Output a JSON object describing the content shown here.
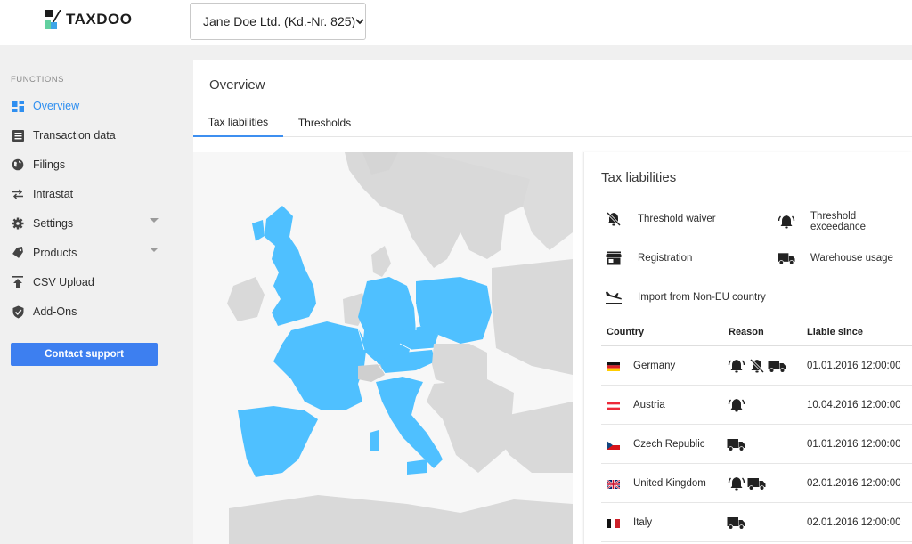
{
  "header": {
    "logo_text": "TAXDOO",
    "client_select": "Jane Doe Ltd. (Kd.-Nr. 825)"
  },
  "sidebar": {
    "heading": "FUNCTIONS",
    "items": [
      {
        "label": "Overview",
        "icon": "dashboard-icon",
        "active": true
      },
      {
        "label": "Transaction data",
        "icon": "list-icon"
      },
      {
        "label": "Filings",
        "icon": "globe-icon"
      },
      {
        "label": "Intrastat",
        "icon": "swap-arrows-icon"
      },
      {
        "label": "Settings",
        "icon": "gear-icon",
        "expandable": true
      },
      {
        "label": "Products",
        "icon": "tag-icon",
        "expandable": true
      },
      {
        "label": "CSV Upload",
        "icon": "upload-icon"
      },
      {
        "label": "Add-Ons",
        "icon": "shield-check-icon"
      }
    ],
    "support_button": "Contact support"
  },
  "main": {
    "title": "Overview",
    "tabs": [
      {
        "label": "Tax liabilities",
        "active": true
      },
      {
        "label": "Thresholds"
      }
    ]
  },
  "panel": {
    "title": "Tax liabilities",
    "legend": {
      "threshold_waiver": "Threshold waiver",
      "threshold_exceedance": "Threshold exceedance",
      "registration": "Registration",
      "warehouse_usage": "Warehouse usage",
      "import_non_eu": "Import from Non-EU country"
    },
    "columns": {
      "country": "Country",
      "reason": "Reason",
      "liable_since": "Liable since"
    },
    "rows": [
      {
        "country": "Germany",
        "reasons": [
          "bell-alert-icon",
          "bell-off-icon",
          "truck-icon"
        ],
        "liable_since": "01.01.2016 12:00:00"
      },
      {
        "country": "Austria",
        "reasons": [
          "bell-alert-icon"
        ],
        "liable_since": "10.04.2016 12:00:00"
      },
      {
        "country": "Czech Republic",
        "reasons": [
          "truck-icon"
        ],
        "liable_since": "01.01.2016 12:00:00"
      },
      {
        "country": "United Kingdom",
        "reasons": [
          "bell-alert-icon",
          "truck-icon"
        ],
        "liable_since": "02.01.2016 12:00:00"
      },
      {
        "country": "Italy",
        "reasons": [
          "truck-icon"
        ],
        "liable_since": "02.01.2016 12:00:00"
      }
    ]
  },
  "colors": {
    "accent": "#3d8ff0",
    "button": "#3d7ff0",
    "highlight_country": "#4fc0ff",
    "other_land": "#d9d9d9"
  }
}
